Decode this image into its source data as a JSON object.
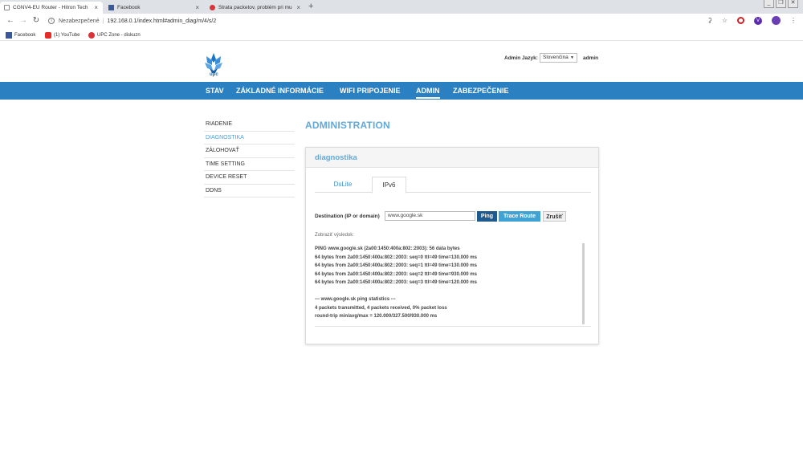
{
  "browser": {
    "tabs": [
      {
        "title": "CGNV4-EU Router - Hitron Tech",
        "active": true
      },
      {
        "title": "Facebook",
        "active": false
      },
      {
        "title": "Strata packetov, problém pri mu",
        "active": false
      }
    ],
    "close_glyph": "×",
    "new_tab_glyph": "+",
    "window_buttons": [
      "_",
      "❐",
      "✕"
    ],
    "security_label": "Nezabezpečené",
    "url": "192.168.0.1/index.html#admin_diag/m/4/s/2",
    "extension_v_label": "V",
    "bookmarks": [
      {
        "label": "Facebook",
        "icon": "facebook-icon"
      },
      {
        "label": "(1) YouTube",
        "icon": "youtube-icon"
      },
      {
        "label": "UPC Zone - diskuzn",
        "icon": "upc-icon"
      }
    ]
  },
  "header": {
    "logo_text": "upc",
    "lang_label": "Admin Jazyk:",
    "lang_value": "Slovenčina",
    "user": "admin"
  },
  "nav": {
    "items": [
      {
        "label": "STAV",
        "active": false
      },
      {
        "label": "ZÁKLADNÉ INFORMÁCIE",
        "active": false
      },
      {
        "label": "WIFI PRIPOJENIE",
        "active": false
      },
      {
        "label": "ADMIN",
        "active": true
      },
      {
        "label": "ZABEZPEČENIE",
        "active": false
      }
    ]
  },
  "sidebar": {
    "items": [
      {
        "label": "RIADENIE",
        "active": false
      },
      {
        "label": "DIAGNOSTIKA",
        "active": true
      },
      {
        "label": "ZÁLOHOVAŤ",
        "active": false
      },
      {
        "label": "TIME SETTING",
        "active": false
      },
      {
        "label": "DEVICE RESET",
        "active": false
      },
      {
        "label": "DDNS",
        "active": false
      }
    ]
  },
  "main": {
    "title": "ADMINISTRATION",
    "panel_title": "diagnostika",
    "tabs": [
      {
        "label": "DsLite",
        "active": false
      },
      {
        "label": "IPv6",
        "active": true
      }
    ],
    "destination_label": "Destination (IP or domain)",
    "destination_value": "www.google.sk",
    "ping_label": "Ping",
    "trace_label": "Trace Route",
    "cancel_label": "Zrušiť",
    "result_label": "Zobraziť výsledok:",
    "result_lines": [
      "PING www.google.sk (2a00:1450:400a:802::2003): 56 data bytes",
      "64 bytes from 2a00:1450:400a:802::2003: seq=0 ttl=49 time=130.000 ms",
      "64 bytes from 2a00:1450:400a:802::2003: seq=1 ttl=49 time=130.000 ms",
      "64 bytes from 2a00:1450:400a:802::2003: seq=2 ttl=49 time=930.000 ms",
      "64 bytes from 2a00:1450:400a:802::2003: seq=3 ttl=49 time=120.000 ms",
      "",
      "--- www.google.sk ping statistics ---",
      "4 packets transmitted, 4 packets received, 0% packet loss",
      "round-trip min/avg/max = 120.000/327.500/930.000 ms"
    ]
  },
  "colors": {
    "nav_bg": "#2a80c0",
    "accent": "#62a8d8",
    "ping_btn": "#1e5a8e",
    "trace_btn": "#3fa3d5"
  }
}
